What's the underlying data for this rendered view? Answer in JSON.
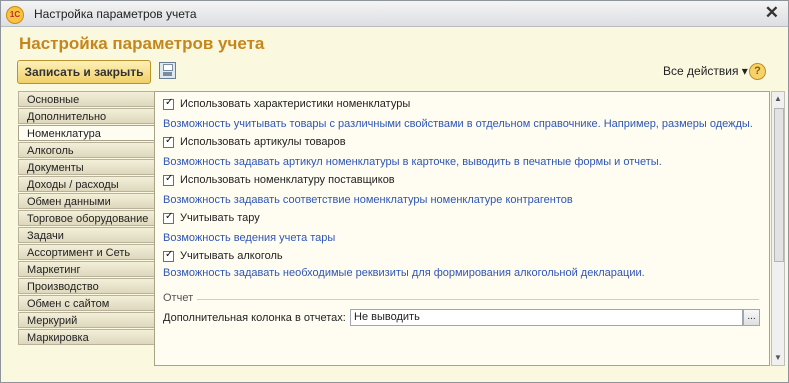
{
  "window": {
    "title": "Настройка параметров учета",
    "app_icon": "1С"
  },
  "page_title": "Настройка параметров учета",
  "toolbar": {
    "save_close": "Записать и закрыть",
    "all_actions": "Все действия ▾",
    "help": "?"
  },
  "tabs": [
    "Основные",
    "Дополнительно",
    "Номенклатура",
    "Алкоголь",
    "Документы",
    "Доходы / расходы",
    "Обмен данными",
    "Торговое оборудование",
    "Задачи",
    "Ассортимент и Сеть",
    "Маркетинг",
    "Производство",
    "Обмен с сайтом",
    "Меркурий",
    "Маркировка"
  ],
  "active_tab": "Номенклатура",
  "options": [
    {
      "label": "Использовать характеристики номенклатуры",
      "checked": true,
      "desc": "Возможность учитывать товары с различными свойствами в отдельном справочнике. Например, размеры одежды."
    },
    {
      "label": "Использовать артикулы товаров",
      "checked": true,
      "desc": "Возможность задавать артикул номенклатуры в карточке, выводить в печатные формы и отчеты."
    },
    {
      "label": "Использовать номенклатуру поставщиков",
      "checked": true,
      "desc": "Возможность задавать соответствие номенклатуры номенклатуре контрагентов"
    },
    {
      "label": "Учитывать тару",
      "checked": true,
      "desc": "Возможность ведения учета тары"
    },
    {
      "label": "Учитывать алкоголь",
      "checked": true,
      "desc": "Возможность задавать необходимые реквизиты для формирования алкогольной декларации."
    }
  ],
  "report": {
    "section": "Отчет",
    "field_label": "Дополнительная колонка в отчетах:",
    "field_value": "Не выводить",
    "select_btn": "..."
  }
}
